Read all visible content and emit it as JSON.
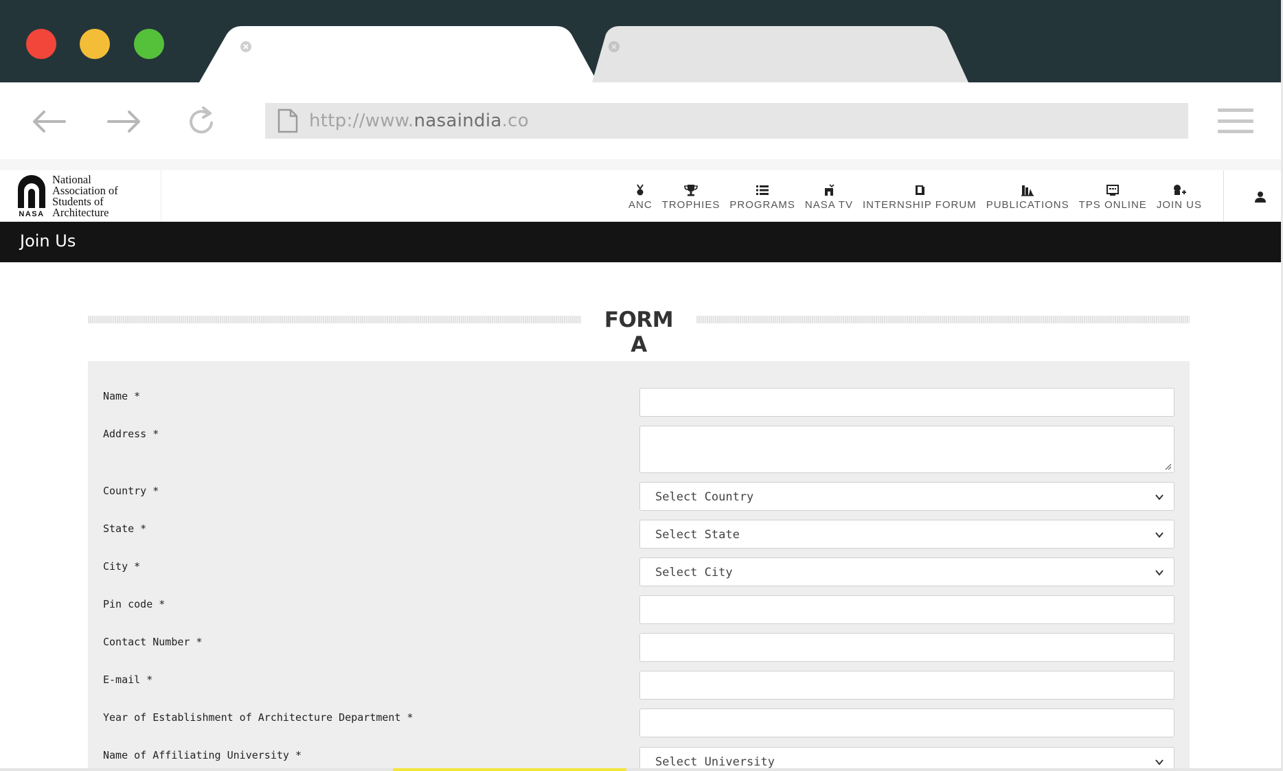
{
  "browser": {
    "url_prefix": "http://www.",
    "url_host": "nasaindia",
    "url_suffix": ".co",
    "tabs": [
      {
        "title": "",
        "active": true
      },
      {
        "title": "",
        "active": false
      }
    ],
    "colors": {
      "chrome": "#24353a",
      "close": "#f2463a",
      "minimize": "#f4bd38",
      "maximize": "#55c13b"
    }
  },
  "site": {
    "logo": {
      "mark_text": "NASA",
      "line1": "National",
      "line2": "Association of",
      "line3": "Students of",
      "line4": "Architecture"
    },
    "nav": [
      {
        "label": "ANC",
        "icon": "medal-icon"
      },
      {
        "label": "TROPHIES",
        "icon": "trophy-icon"
      },
      {
        "label": "PROGRAMS",
        "icon": "list-icon"
      },
      {
        "label": "NASA TV",
        "icon": "tv-icon"
      },
      {
        "label": "INTERNSHIP FORUM",
        "icon": "book-icon"
      },
      {
        "label": "PUBLICATIONS",
        "icon": "publications-icon"
      },
      {
        "label": "TPS ONLINE",
        "icon": "monitor-icon"
      },
      {
        "label": "JOIN US",
        "icon": "add-user-icon"
      }
    ],
    "user_icon": "user-icon"
  },
  "page": {
    "title": "Join Us",
    "form_title": "FORM A"
  },
  "form": {
    "fields": [
      {
        "label": "Name *",
        "type": "text",
        "value": ""
      },
      {
        "label": "Address *",
        "type": "textarea",
        "value": ""
      },
      {
        "label": "Country *",
        "type": "select",
        "value": "Select Country"
      },
      {
        "label": "State *",
        "type": "select",
        "value": "Select State"
      },
      {
        "label": "City *",
        "type": "select",
        "value": "Select City"
      },
      {
        "label": "Pin code *",
        "type": "text",
        "value": ""
      },
      {
        "label": "Contact Number *",
        "type": "text",
        "value": ""
      },
      {
        "label": "E-mail *",
        "type": "text",
        "value": ""
      },
      {
        "label": "Year of Establishment of Architecture Department *",
        "type": "text",
        "value": ""
      },
      {
        "label": "Name of Affiliating University *",
        "type": "select",
        "value": "Select University"
      }
    ]
  }
}
